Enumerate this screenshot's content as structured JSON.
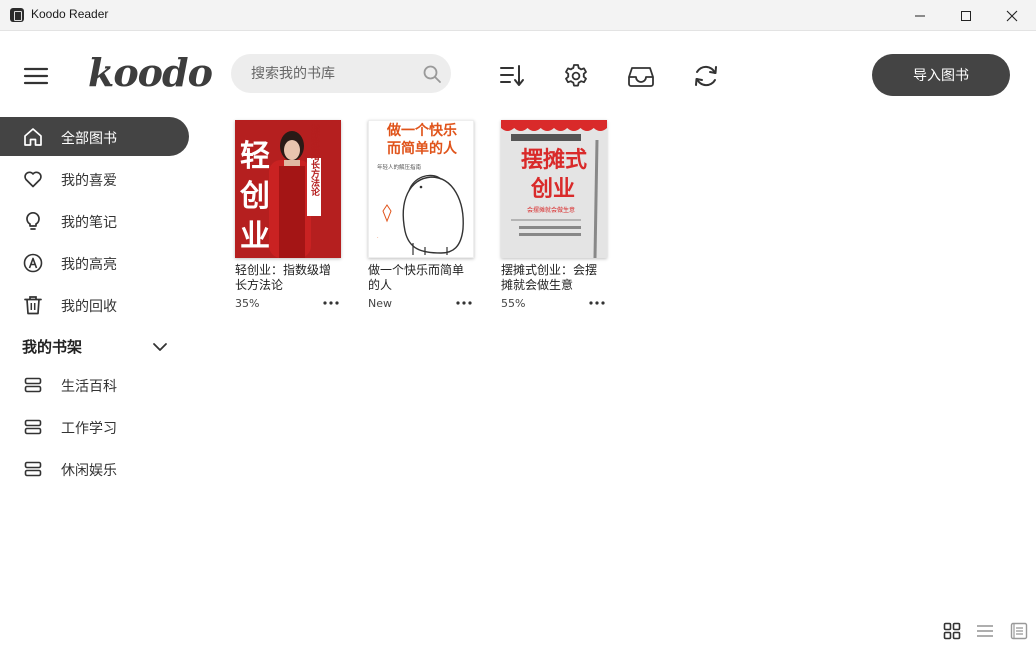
{
  "window": {
    "title": "Koodo Reader"
  },
  "header": {
    "logo": "koodo",
    "search_placeholder": "搜索我的书库",
    "import_label": "导入图书"
  },
  "sidebar": {
    "items": [
      {
        "label": "全部图书",
        "icon": "home-icon",
        "active": true
      },
      {
        "label": "我的喜爱",
        "icon": "heart-icon"
      },
      {
        "label": "我的笔记",
        "icon": "bulb-icon"
      },
      {
        "label": "我的高亮",
        "icon": "highlight-icon"
      },
      {
        "label": "我的回收",
        "icon": "trash-icon"
      }
    ],
    "shelf_title": "我的书架",
    "shelves": [
      {
        "label": "生活百科",
        "icon": "shelf-icon"
      },
      {
        "label": "工作学习",
        "icon": "shelf-icon"
      },
      {
        "label": "休闲娱乐",
        "icon": "shelf-icon"
      }
    ]
  },
  "books": [
    {
      "title": "轻创业：指数级增长方法论",
      "progress": "35%",
      "cover_text": "轻创业",
      "cover_subtitle": "指数级增长方法论",
      "cover_color": "#b51f1f"
    },
    {
      "title": "做一个快乐而简单的人",
      "progress": "New",
      "cover_text": "做一个快乐而简单的人",
      "cover_subtitle": "年轻人的解压指南",
      "cover_color": "#ffffff"
    },
    {
      "title": "摆摊式创业：会摆摊就会做生意",
      "progress": "55%",
      "cover_text": "摆摊式创业",
      "cover_subtitle": "会摆摊就会做生意",
      "cover_color": "#e4e4e4"
    }
  ],
  "colors": {
    "accent": "#444444",
    "search_bg": "#ededed",
    "cover_red": "#d22a2a"
  }
}
